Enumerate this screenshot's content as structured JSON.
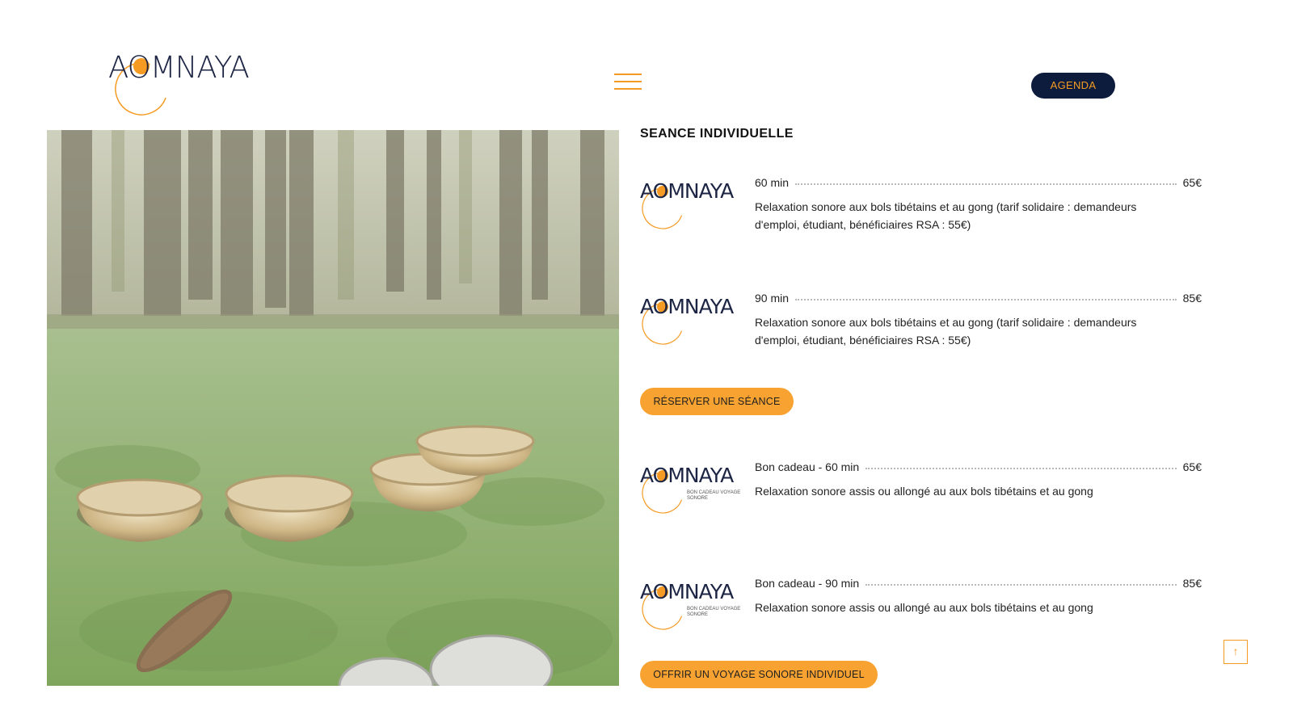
{
  "header": {
    "logo_text": "AOMNAYA",
    "agenda_label": "AGENDA"
  },
  "section": {
    "title": "SEANCE INDIVIDUELLE"
  },
  "items": [
    {
      "duration": "60 min",
      "price": "65€",
      "description": "Relaxation sonore aux bols tibétains et au gong (tarif solidaire : demandeurs d'emploi, étudiant, bénéficiaires RSA : 55€)",
      "logo_text": "AOMNAYA",
      "logo_sub": ""
    },
    {
      "duration": "90 min",
      "price": "85€",
      "description": "Relaxation sonore aux bols tibétains et au gong (tarif solidaire : demandeurs d'emploi, étudiant, bénéficiaires RSA : 55€)",
      "logo_text": "AOMNAYA",
      "logo_sub": ""
    },
    {
      "duration": "Bon cadeau - 60 min",
      "price": "65€",
      "description": "Relaxation sonore assis ou allongé au aux bols tibétains et au gong",
      "logo_text": "AOMNAYA",
      "logo_sub": "BON CADEAU VOYAGE SONORE"
    },
    {
      "duration": "Bon cadeau - 90 min",
      "price": "85€",
      "description": "Relaxation sonore assis ou allongé au aux bols tibétains et au gong",
      "logo_text": "AOMNAYA",
      "logo_sub": "BON CADEAU VOYAGE SONORE"
    }
  ],
  "buttons": {
    "reserve_label": "RÉSERVER UNE SÉANCE",
    "gift_label": "OFFRIR UN VOYAGE SONORE INDIVIDUEL",
    "scroll_top_icon": "arrow-up-icon"
  },
  "colors": {
    "accent": "#f59b23",
    "navy": "#0d1c3c",
    "button_orange": "#f8a231"
  }
}
